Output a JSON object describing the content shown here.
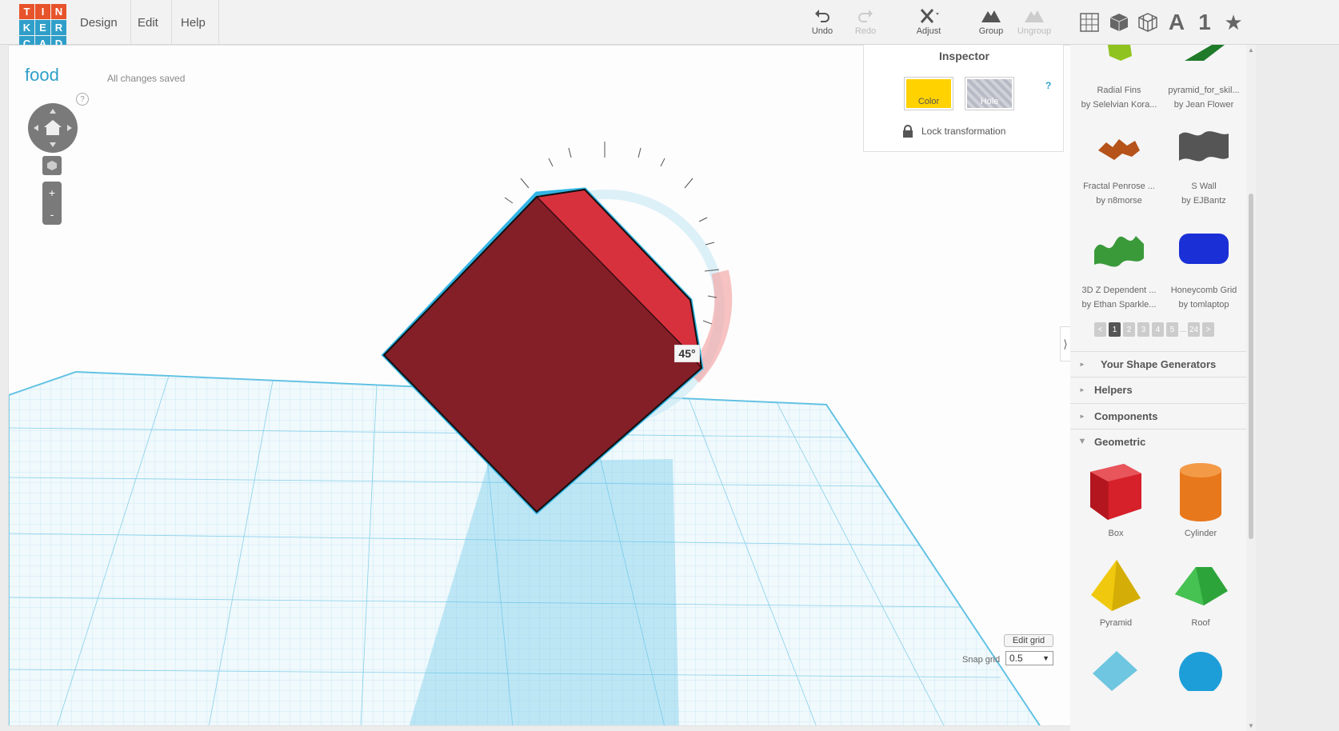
{
  "app": {
    "logo_letters": [
      "T",
      "I",
      "N",
      "K",
      "E",
      "R",
      "C",
      "A",
      "D"
    ],
    "logo_colors": [
      "#e7532b",
      "#e7532b",
      "#e7532b",
      "#2f9fc9",
      "#2f9fc9",
      "#2f9fc9",
      "#2f9fc9",
      "#2f9fc9",
      "#2f9fc9"
    ],
    "accent": "#2f9fc9"
  },
  "menu": {
    "design": "Design",
    "edit": "Edit",
    "help": "Help"
  },
  "toolbar": {
    "undo": "Undo",
    "redo": "Redo",
    "adjust": "Adjust",
    "group": "Group",
    "ungroup": "Ungroup"
  },
  "view_icons": [
    "workplane-grid-icon",
    "solid-box-icon",
    "wireframe-box-icon",
    "text-a-icon",
    "number-one-icon",
    "star-icon"
  ],
  "view_text": {
    "a": "A",
    "one": "1",
    "star": "★"
  },
  "design": {
    "name": "food",
    "save_status": "All changes saved"
  },
  "workplane": {
    "rotation_angle": "45",
    "help": "?",
    "zoom_in": "+",
    "zoom_out": "-"
  },
  "grid": {
    "edit_label": "Edit grid",
    "snap_label": "Snap grid",
    "snap_value": "0.5"
  },
  "inspector": {
    "title": "Inspector",
    "color_label": "Color",
    "hole_label": "Hole",
    "help": "?",
    "lock_label": "Lock transformation",
    "color": "#ffd200"
  },
  "panel_toggle": "⟩",
  "community_shapes": [
    {
      "name": "Radial Fins",
      "author": "by Selelvian Kora..."
    },
    {
      "name": "pyramid_for_skil...",
      "author": "by Jean Flower"
    },
    {
      "name": "Fractal Penrose ...",
      "author": "by n8morse"
    },
    {
      "name": "S Wall",
      "author": "by EJBantz"
    },
    {
      "name": "3D Z Dependent ...",
      "author": "by Ethan Sparkle..."
    },
    {
      "name": "Honeycomb Grid",
      "author": "by tomlaptop"
    }
  ],
  "pager": {
    "prev": "<",
    "pages": [
      "1",
      "2",
      "3",
      "4",
      "5"
    ],
    "dots": "...",
    "last": "24",
    "next": ">"
  },
  "sections": {
    "generators": "Your Shape Generators",
    "helpers": "Helpers",
    "components": "Components",
    "geometric": "Geometric"
  },
  "geometric_shapes": [
    {
      "name": "Box",
      "color": "#d6202a"
    },
    {
      "name": "Cylinder",
      "color": "#e8781c"
    },
    {
      "name": "Pyramid",
      "color": "#f0c90e"
    },
    {
      "name": "Roof",
      "color": "#2da43a"
    }
  ],
  "selected_object": {
    "color": "#841f28",
    "top_color": "#d7313e",
    "outline": "#33b5e5"
  }
}
